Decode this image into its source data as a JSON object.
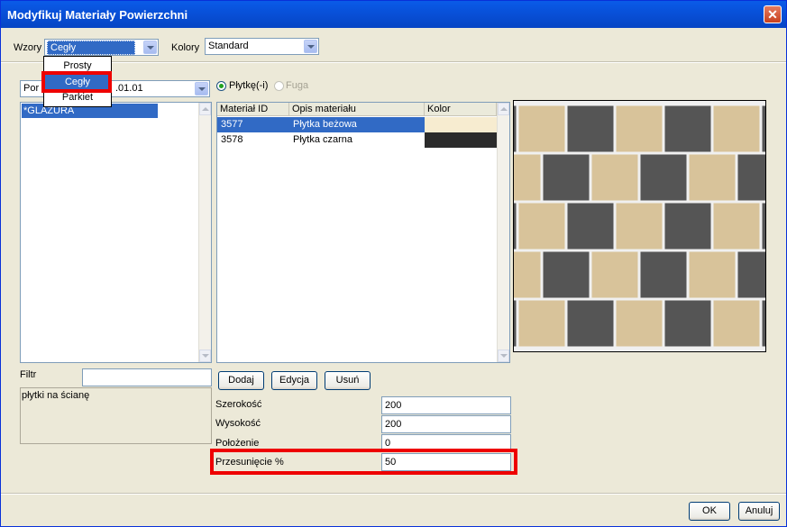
{
  "window": {
    "title": "Modyfikuj Materiały Powierzchni",
    "close_symbol": "✕"
  },
  "top": {
    "wzory_label": "Wzory",
    "wzory_value": "Cegły",
    "kolory_label": "Kolory",
    "kolory_value": "Standard"
  },
  "wzory_dropdown": {
    "options": [
      "Prosty",
      "Cegły",
      "Parkiet"
    ],
    "selected_index": 1
  },
  "category_combo": {
    "value_left": "Por",
    "value_right": ".01.01"
  },
  "radios": {
    "tiles_label": "Płytkę(-i)",
    "tiles_checked": true,
    "grout_label": "Fuga",
    "grout_enabled": false
  },
  "left_list": {
    "items": [
      "*GLAZURA"
    ],
    "selected_index": 0
  },
  "materials_table": {
    "headers": [
      "Materiał ID",
      "Opis materiału",
      "Kolor"
    ],
    "rows": [
      {
        "id": "3577",
        "desc": "Płytka beżowa",
        "color": "#f7ecd0",
        "selected": true
      },
      {
        "id": "3578",
        "desc": "Płytka czarna",
        "color": "#2b2b2b",
        "selected": false
      }
    ]
  },
  "buttons": {
    "add": "Dodaj",
    "edit": "Edycja",
    "delete": "Usuń",
    "ok": "OK",
    "cancel": "Anuluj"
  },
  "filter": {
    "label": "Filtr",
    "value": ""
  },
  "description": "płytki na ścianę",
  "properties": [
    {
      "label": "Szerokość",
      "value": "200"
    },
    {
      "label": "Wysokość",
      "value": "200"
    },
    {
      "label": "Położenie",
      "value": "0"
    },
    {
      "label": "Przesunięcie %",
      "value": "50"
    }
  ],
  "colors": {
    "tile_beige": "#d8c39a",
    "tile_dark": "#555555",
    "grout": "#f0f0f0",
    "highlight": "#e00000",
    "selection": "#316ac5"
  }
}
